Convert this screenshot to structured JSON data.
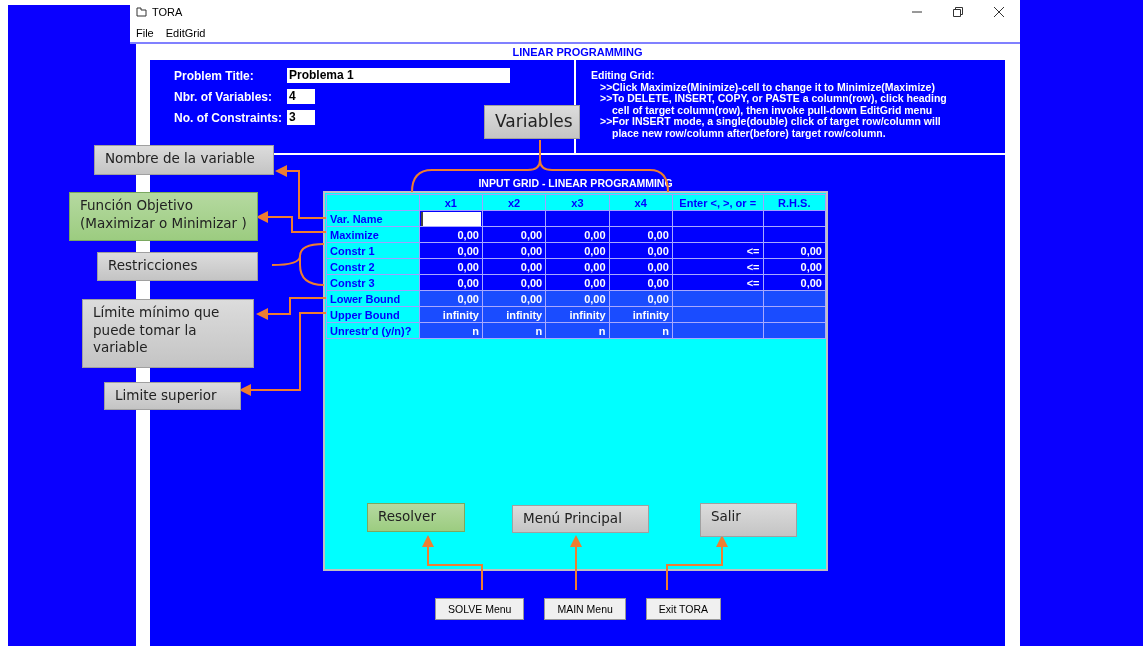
{
  "window": {
    "title": "TORA"
  },
  "menu": [
    "File",
    "EditGrid"
  ],
  "header": "LINEAR PROGRAMMING",
  "problem_fields": [
    {
      "label": "Problem Title:",
      "value": "Problema 1",
      "kind": "wide"
    },
    {
      "label": "Nbr. of Variables:",
      "value": "4",
      "kind": "short"
    },
    {
      "label": "No. of Constraints:",
      "value": "3",
      "kind": "short"
    }
  ],
  "instructions": {
    "title": "Editing Grid:",
    "items": [
      {
        "lines": [
          ">>Click Maximize(Minimize)-cell to change it to Minimize(Maximize)"
        ]
      },
      {
        "lines": [
          ">>To DELETE, INSERT, COPY, or PASTE a column(row), click heading",
          "cell of target column(row), then invoke pull-down EditGrid menu"
        ]
      },
      {
        "lines": [
          ">>For INSERT mode, a single(double) click of target row/column will",
          "place new row/column after(before) target row/column."
        ]
      }
    ]
  },
  "grid": {
    "title": "INPUT GRID - LINEAR PROGRAMMING",
    "columns": [
      "x1",
      "x2",
      "x3",
      "x4",
      "Enter <, >, or =",
      "R.H.S."
    ],
    "rows": [
      {
        "label": "Var. Name",
        "kind": "name"
      },
      {
        "label": "Maximize",
        "kind": "value",
        "cells": [
          "0,00",
          "0,00",
          "0,00",
          "0,00"
        ]
      },
      {
        "label": "Constr 1",
        "kind": "value",
        "cells": [
          "0,00",
          "0,00",
          "0,00",
          "0,00",
          "<=",
          "0,00"
        ]
      },
      {
        "label": "Constr 2",
        "kind": "value",
        "cells": [
          "0,00",
          "0,00",
          "0,00",
          "0,00",
          "<=",
          "0,00"
        ]
      },
      {
        "label": "Constr 3",
        "kind": "value",
        "cells": [
          "0,00",
          "0,00",
          "0,00",
          "0,00",
          "<=",
          "0,00"
        ]
      },
      {
        "label": "Lower Bound",
        "kind": "bound",
        "cells": [
          "0,00",
          "0,00",
          "0,00",
          "0,00"
        ]
      },
      {
        "label": "Upper Bound",
        "kind": "bound",
        "cells": [
          "infinity",
          "infinity",
          "infinity",
          "infinity"
        ]
      },
      {
        "label": "Unrestr'd (y/n)?",
        "kind": "bound",
        "cells": [
          "n",
          "n",
          "n",
          "n"
        ]
      }
    ]
  },
  "buttons": [
    "SOLVE Menu",
    "MAIN Menu",
    "Exit TORA"
  ],
  "annotations": [
    {
      "text": "Variables",
      "kind": "gray"
    },
    {
      "text": "Nombre de la variable",
      "kind": "gray"
    },
    {
      "text": "Función Objetivo (Maximizar o Minimizar )",
      "kind": "green"
    },
    {
      "text": "Restricciones",
      "kind": "gray"
    },
    {
      "text": "Límite mínimo  que puede tomar la variable",
      "kind": "gray"
    },
    {
      "text": "Limite superior",
      "kind": "gray"
    },
    {
      "text": "Resolver",
      "kind": "green"
    },
    {
      "text": "Menú Principal",
      "kind": "gray"
    },
    {
      "text": "Salir",
      "kind": "gray"
    }
  ]
}
